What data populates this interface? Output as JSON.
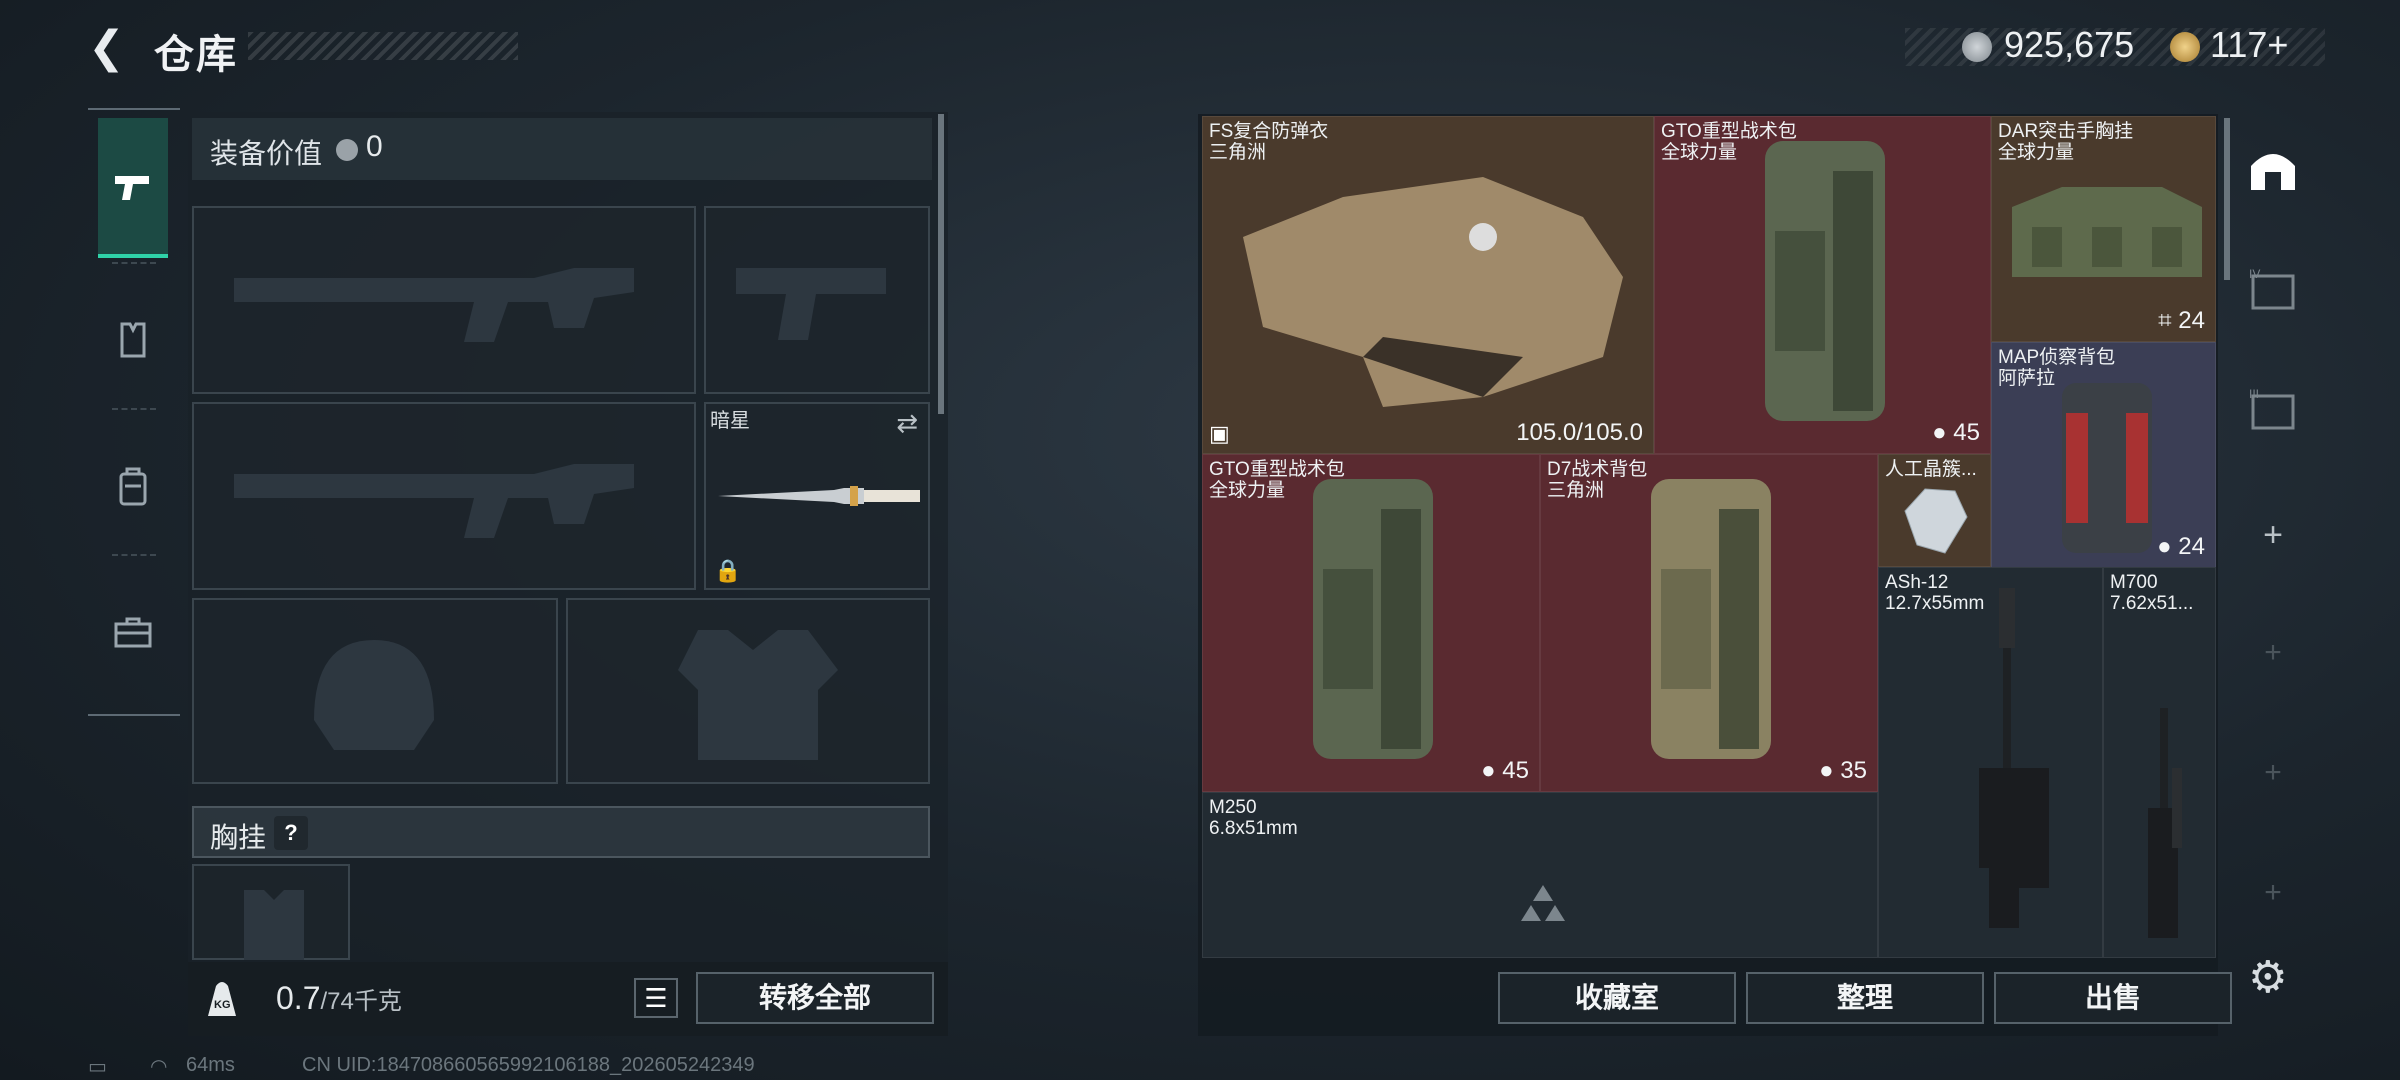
{
  "header": {
    "title": "仓库",
    "currency_a": "925,675",
    "currency_b": "117+"
  },
  "nav": {
    "items": [
      {
        "name": "weapon",
        "icon": "pistol-icon"
      },
      {
        "name": "armor",
        "icon": "vest-icon"
      },
      {
        "name": "backpack",
        "icon": "backpack-icon"
      },
      {
        "name": "toolbox",
        "icon": "toolbox-icon"
      }
    ],
    "active": 0
  },
  "loadout": {
    "value_label": "装备价值",
    "value": "0",
    "melee_name": "暗星",
    "chest_label": "胸挂",
    "chest_help": "?",
    "weight_current": "0.7",
    "weight_max": "/74千克",
    "transfer_all": "转移全部"
  },
  "stash": {
    "items": [
      {
        "name": "FS复合防弹衣",
        "sub": "三角洲",
        "count": "105.0/105.0",
        "color": "#4a3a2c"
      },
      {
        "name": "GTO重型战术包",
        "sub": "全球力量",
        "count": "45",
        "color": "#5a2a30"
      },
      {
        "name": "DAR突击手胸挂",
        "sub": "全球力量",
        "count": "24",
        "color": "#4a3a2c"
      },
      {
        "name": "MAP侦察背包",
        "sub": "阿萨拉",
        "count": "24",
        "color": "#3b3e55"
      },
      {
        "name": "GTO重型战术包",
        "sub": "全球力量",
        "count": "45",
        "color": "#5a2a30"
      },
      {
        "name": "D7战术背包",
        "sub": "三角洲",
        "count": "35",
        "color": "#5a2a30"
      },
      {
        "name": "人工晶簇...",
        "sub": "",
        "count": "",
        "color": "#4a3a2c"
      },
      {
        "name": "ASh-12",
        "sub": "12.7x55mm",
        "count": "",
        "color": "#222b32"
      },
      {
        "name": "M700",
        "sub": "7.62x51...",
        "count": "",
        "color": "#222b32"
      },
      {
        "name": "M250",
        "sub": "6.8x51mm",
        "count": "",
        "color": "#222b32"
      }
    ],
    "buttons": {
      "collection": "收藏室",
      "sort": "整理",
      "sell": "出售"
    }
  },
  "status": {
    "ping": "64ms",
    "uid": "CN UID:1847086605659921061​88_202605242349"
  }
}
